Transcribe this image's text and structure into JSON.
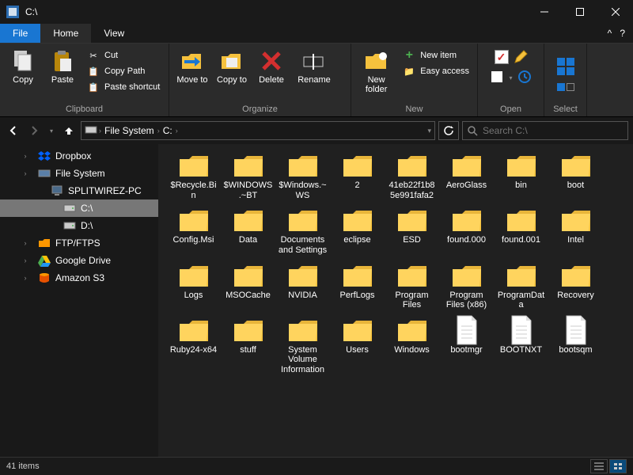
{
  "window": {
    "title": "C:\\"
  },
  "tabs": {
    "file": "File",
    "home": "Home",
    "view": "View"
  },
  "ribbon": {
    "clipboard": {
      "label": "Clipboard",
      "copy": "Copy",
      "paste": "Paste",
      "cut": "Cut",
      "copy_path": "Copy Path",
      "paste_shortcut": "Paste shortcut"
    },
    "organize": {
      "label": "Organize",
      "move_to": "Move to",
      "copy_to": "Copy to",
      "delete": "Delete",
      "rename": "Rename"
    },
    "new": {
      "label": "New",
      "new_folder": "New folder",
      "new_item": "New item",
      "easy_access": "Easy access"
    },
    "open": {
      "label": "Open"
    },
    "select": {
      "label": "Select"
    }
  },
  "breadcrumb": {
    "root": "File System",
    "current": "C:"
  },
  "search": {
    "placeholder": "Search C:\\"
  },
  "sidebar": {
    "items": [
      {
        "label": "Dropbox",
        "icon": "dropbox",
        "indent": 22
      },
      {
        "label": "File System",
        "icon": "disk",
        "indent": 22
      },
      {
        "label": "SPLITWIREZ-PC",
        "icon": "computer",
        "indent": 38
      },
      {
        "label": "C:\\",
        "icon": "drive",
        "indent": 54,
        "selected": true
      },
      {
        "label": "D:\\",
        "icon": "drive",
        "indent": 54
      },
      {
        "label": "FTP/FTPS",
        "icon": "folder-orange",
        "indent": 22
      },
      {
        "label": "Google Drive",
        "icon": "gdrive",
        "indent": 22
      },
      {
        "label": "Amazon S3",
        "icon": "s3",
        "indent": 22
      }
    ]
  },
  "items": [
    {
      "name": "$Recycle.Bin",
      "type": "folder"
    },
    {
      "name": "$WINDOWS.~BT",
      "type": "folder"
    },
    {
      "name": "$Windows.~WS",
      "type": "folder"
    },
    {
      "name": "2",
      "type": "folder"
    },
    {
      "name": "41eb22f1b85e991fafa2",
      "type": "folder"
    },
    {
      "name": "AeroGlass",
      "type": "folder"
    },
    {
      "name": "bin",
      "type": "folder"
    },
    {
      "name": "boot",
      "type": "folder"
    },
    {
      "name": "Config.Msi",
      "type": "folder"
    },
    {
      "name": "Data",
      "type": "folder"
    },
    {
      "name": "Documents and Settings",
      "type": "folder"
    },
    {
      "name": "eclipse",
      "type": "folder"
    },
    {
      "name": "ESD",
      "type": "folder"
    },
    {
      "name": "found.000",
      "type": "folder"
    },
    {
      "name": "found.001",
      "type": "folder"
    },
    {
      "name": "Intel",
      "type": "folder"
    },
    {
      "name": "Logs",
      "type": "folder"
    },
    {
      "name": "MSOCache",
      "type": "folder"
    },
    {
      "name": "NVIDIA",
      "type": "folder"
    },
    {
      "name": "PerfLogs",
      "type": "folder"
    },
    {
      "name": "Program Files",
      "type": "folder"
    },
    {
      "name": "Program Files (x86)",
      "type": "folder"
    },
    {
      "name": "ProgramData",
      "type": "folder"
    },
    {
      "name": "Recovery",
      "type": "folder"
    },
    {
      "name": "Ruby24-x64",
      "type": "folder"
    },
    {
      "name": "stuff",
      "type": "folder"
    },
    {
      "name": "System Volume Information",
      "type": "folder"
    },
    {
      "name": "Users",
      "type": "folder"
    },
    {
      "name": "Windows",
      "type": "folder"
    },
    {
      "name": "bootmgr",
      "type": "file"
    },
    {
      "name": "BOOTNXT",
      "type": "file"
    },
    {
      "name": "bootsqm",
      "type": "file"
    }
  ],
  "status": {
    "count": "41 items"
  }
}
